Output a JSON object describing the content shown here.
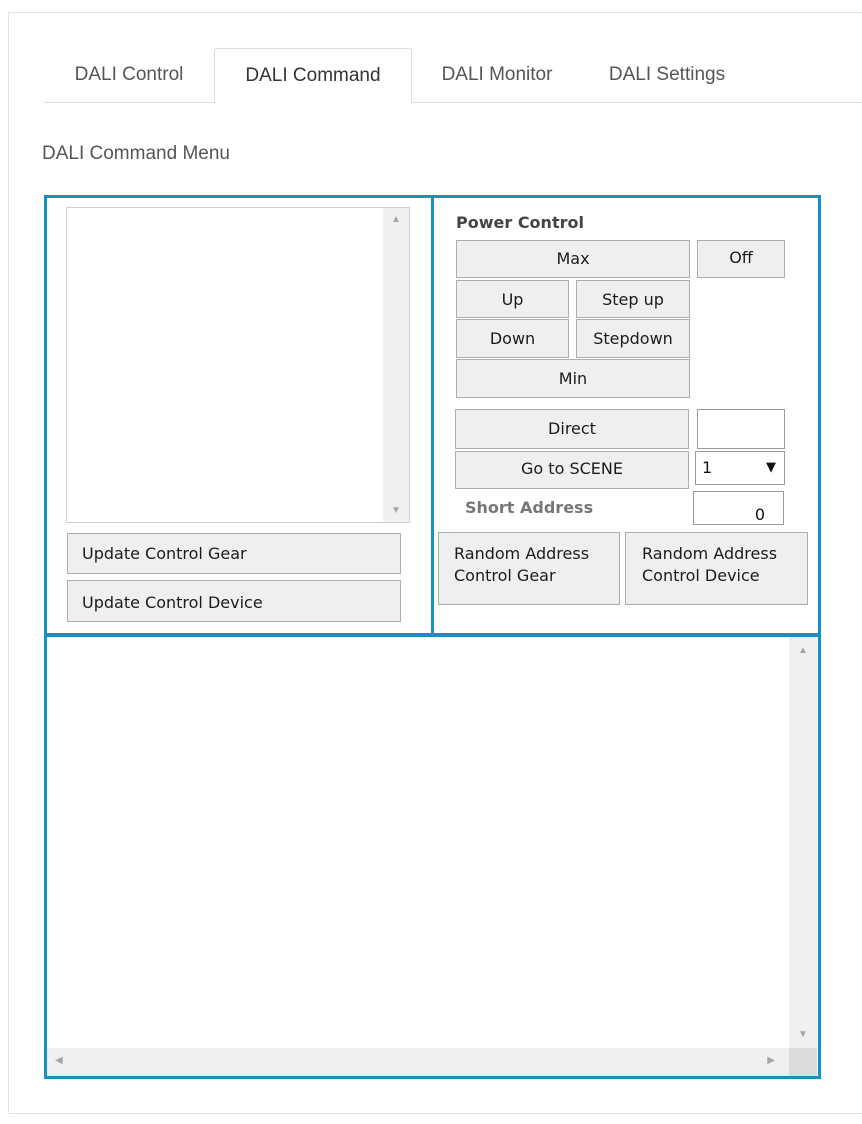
{
  "tabs": [
    {
      "label": "DALI Control"
    },
    {
      "label": "DALI Command"
    },
    {
      "label": "DALI Monitor"
    },
    {
      "label": "DALI Settings"
    }
  ],
  "active_tab": "DALI Command",
  "menu_title": "DALI Command Menu",
  "update_buttons": {
    "control_gear": "Update  Control Gear",
    "control_device": "Update  Control Device"
  },
  "power_control": {
    "title": "Power Control",
    "max": "Max",
    "off": "Off",
    "up": "Up",
    "step_up": "Step up",
    "down": "Down",
    "stepdown": "Stepdown",
    "min": "Min",
    "direct": "Direct",
    "direct_value": "",
    "go_to_scene": "Go to SCENE",
    "scene_selected": "1",
    "short_address_label": "Short Address",
    "short_address_value": "0"
  },
  "random_address": {
    "gear_line1": "Random Address",
    "gear_line2": "Control Gear",
    "device_line1": "Random Address",
    "device_line2": "Control Device"
  },
  "colors": {
    "panel_border": "#1a8fc4",
    "button_bg": "#efefef",
    "scrollbar_bg": "#f0f0f0"
  },
  "icons": {
    "scroll_up": "▲",
    "scroll_down": "▼",
    "scroll_left": "◀",
    "scroll_right": "▶",
    "dropdown": "▼"
  }
}
